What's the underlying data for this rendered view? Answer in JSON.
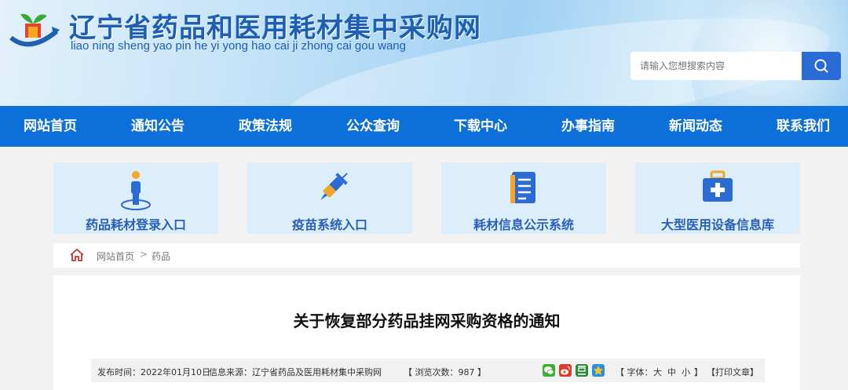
{
  "header": {
    "title": "辽宁省药品和医用耗材集中采购网",
    "subtitle": "liao ning sheng yao pin he yi yong hao cai ji zhong cai gou wang"
  },
  "search": {
    "placeholder": "请输入您想搜索内容",
    "icon": "search-icon"
  },
  "nav": {
    "items": [
      "网站首页",
      "通知公告",
      "政策法规",
      "公众查询",
      "下载中心",
      "办事指南",
      "新闻动态",
      "联系我们"
    ]
  },
  "cards": [
    {
      "label": "药品耗材登录入口",
      "icon": "person-pin-icon"
    },
    {
      "label": "疫苗系统入口",
      "icon": "syringe-icon"
    },
    {
      "label": "耗材信息公示系统",
      "icon": "document-icon"
    },
    {
      "label": "大型医用设备信息库",
      "icon": "medical-kit-icon"
    }
  ],
  "breadcrumb": {
    "home": "网站首页",
    "separator": ">",
    "current": "药品"
  },
  "article": {
    "title": "关于恢复部分药品挂网采购资格的通知",
    "publish_time": "发布时间：2022年01月10日",
    "source": "信息来源：辽宁省药品及医用耗材集中采购网",
    "views": "【 浏览次数：987 】",
    "font_size_label": "【 字体：",
    "font_large": "大",
    "font_medium": "中",
    "font_small": "小",
    "font_close": "】",
    "print": "【打印文章】"
  },
  "colors": {
    "nav_bg": "#0d6fd9",
    "card_bg": "#dceefb",
    "accent": "#2a5fb8",
    "search_btn": "#2b6bd6"
  }
}
